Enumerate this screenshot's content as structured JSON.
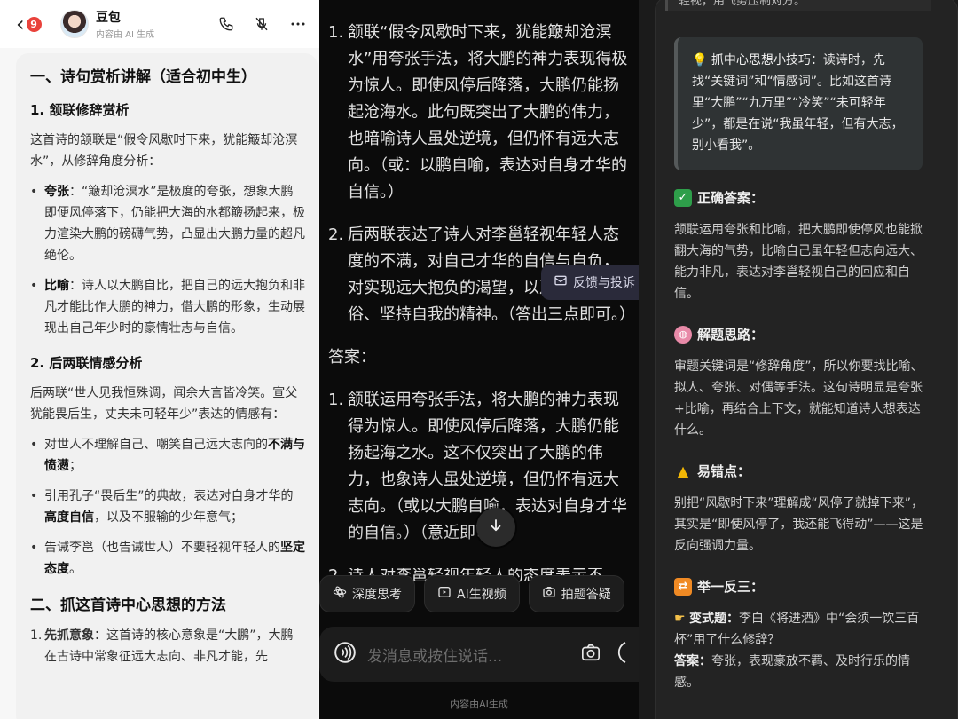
{
  "panel1": {
    "header": {
      "back_badge": "9",
      "bot_name": "豆包",
      "bot_sub": "内容由 AI 生成"
    },
    "title": "一、诗句赏析讲解（适合初中生）",
    "s1_heading": "1. 颔联修辞赏析",
    "s1_intro": "这首诗的颔联是“假令风歇时下来，犹能簸却沧溟水”，从修辞角度分析：",
    "s1_bullets": [
      {
        "bold": "夸张",
        "text": "：“簸却沧溟水”是极度的夸张，想象大鹏即便风停落下，仍能把大海的水都簸扬起来，极力渲染大鹏的磅礴气势，凸显出大鹏力量的超凡绝伦。"
      },
      {
        "bold": "比喻",
        "text": "：诗人以大鹏自比，把自己的远大抱负和非凡才能比作大鹏的神力，借大鹏的形象，生动展现出自己年少时的豪情壮志与自信。"
      }
    ],
    "s2_heading": "2. 后两联情感分析",
    "s2_intro": "后两联“世人见我恒殊调，闻余大言皆冷笑。宣父犹能畏后生，丈夫未可轻年少”表达的情感有：",
    "s2_bullets": [
      {
        "pre": "对世人不理解自己、嘲笑自己远大志向的",
        "bold": "不满与愤懑",
        "post": "；"
      },
      {
        "pre": "引用孔子“畏后生”的典故，表达对自身才华的",
        "bold": "高度自信",
        "post": "，以及不服输的少年意气；"
      },
      {
        "pre": "告诫李邕（也告诫世人）不要轻视年轻人的",
        "bold": "坚定态度",
        "post": "。"
      }
    ],
    "title2": "二、抓这首诗中心思想的方法",
    "m1_bold": "先抓意象",
    "m1_text": "：这首诗的核心意象是“大鹏”，大鹏在古诗中常象征远大志向、非凡才能，先"
  },
  "panel2": {
    "items_top": [
      {
        "n": "1.",
        "text": "颔联“假令风歇时下来，犹能簸却沧溟水”用夸张手法，将大鹏的神力表现得极为惊人。即使风停后降落，大鹏仍能扬起沧海水。此句既突出了大鹏的伟力，也暗喻诗人虽处逆境，但仍怀有远大志向。（或：以鹏自喻，表达对自身才华的自信。）"
      },
      {
        "n": "2.",
        "text": "后两联表达了诗人对李邕轻视年轻人态度的不满，对自己才华的自信与自负，对实现远大抱负的渴望，以及不畏流俗、坚持自我的精神。（答出三点即可。）"
      }
    ],
    "feedback_label": "反馈与投诉",
    "answer_label": "答案：",
    "items_bottom": [
      {
        "n": "1.",
        "text": "颔联运用夸张手法，将大鹏的神力表现得为惊人。即使风停后降落，大鹏仍能扬起海之水。这不仅突出了大鹏的伟力，也象诗人虽处逆境，但仍怀有远大志向。（或以大鹏自喻，表达对自身才华的自信。）（意近即可）"
      },
      {
        "n": "2.",
        "text": "诗人对李邕轻视年轻人的态度表示不满；"
      }
    ],
    "chips": [
      {
        "icon": "deep-think-icon",
        "label": "深度思考"
      },
      {
        "icon": "ai-video-icon",
        "label": "AI生视频"
      },
      {
        "icon": "photo-answer-icon",
        "label": "拍题答疑"
      }
    ],
    "input_placeholder": "发消息或按住说话...",
    "footer": "内容由AI生成"
  },
  "panel3": {
    "top_cut": "轻视，用飞势压制对方。",
    "tip_label": "抓中心思想小技巧：",
    "tip_text": "读诗时，先找“关键词”和“情感词”。比如这首诗里“大鹏”“九万里”“冷笑”“未可轻年少”，都是在说“我虽年轻，但有大志，别小看我”。",
    "correct_heading": "正确答案：",
    "correct_text": "颔联运用夸张和比喻，把大鹏即使停风也能掀翻大海的气势，比喻自己虽年轻但志向远大、能力非凡，表达对李邕轻视自己的回应和自信。",
    "think_heading": "解题思路：",
    "think_text": "审题关键词是“修辞角度”，所以你要找比喻、拟人、夸张、对偶等手法。这句诗明显是夸张+比喻，再结合上下文，就能知道诗人想表达什么。",
    "error_heading": "易错点：",
    "error_text": "别把“风歇时下来”理解成“风停了就掉下来”，其实是“即使风停了，我还能飞得动”——这是反向强调力量。",
    "extend_heading": "举一反三：",
    "variant_label": "变式题：",
    "variant_text": "李白《将进酒》中“会须一饮三百杯”用了什么修辞？",
    "answer_label": "答案：",
    "answer_text": "夸张，表现豪放不羁、及时行乐的情感。"
  },
  "colors": {
    "badge_red": "#e9423b",
    "dark_bg": "#0b0b0b",
    "grey_bg": "#1b1b1b",
    "check_green": "#2e9e4a",
    "warn_yellow": "#f2b705",
    "swap_orange": "#f08a24"
  }
}
